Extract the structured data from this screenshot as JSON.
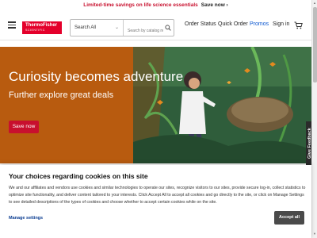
{
  "promo_bar": {
    "text": "Limited-time savings on life science essentials",
    "link": "Save now ›"
  },
  "header": {
    "logo_top": "ThermoFisher",
    "logo_bottom": "SCIENTIFIC",
    "search_category": "Search All",
    "search_placeholder": "Search by catalog num",
    "nav": [
      "Order Status",
      "Quick Order",
      "Promos",
      "Sign in"
    ]
  },
  "hero": {
    "title": "Curiosity becomes adventure",
    "subtitle": "Further explore great deals",
    "button": "Save now"
  },
  "feedback": "Give Feedback",
  "cookie": {
    "title": "Your choices regarding cookies on this site",
    "text": "We and our affiliates and vendors use cookies and similar technologies to operate our sites, recognize visitors to our sites, provide secure log-in, collect statistics to optimize site functionality, and deliver content tailored to your interests. Click Accept All to accept all cookies and go directly to the site, or click on Manage Settings to see detailed descriptions of the types of cookies and choose whether to accept certain cookies while on the site.",
    "manage": "Manage settings",
    "accept": "Accept all"
  },
  "colors": {
    "brand_red": "#c8102e",
    "hero_orange": "#b85b0f",
    "promos_blue": "#0b57d0"
  }
}
